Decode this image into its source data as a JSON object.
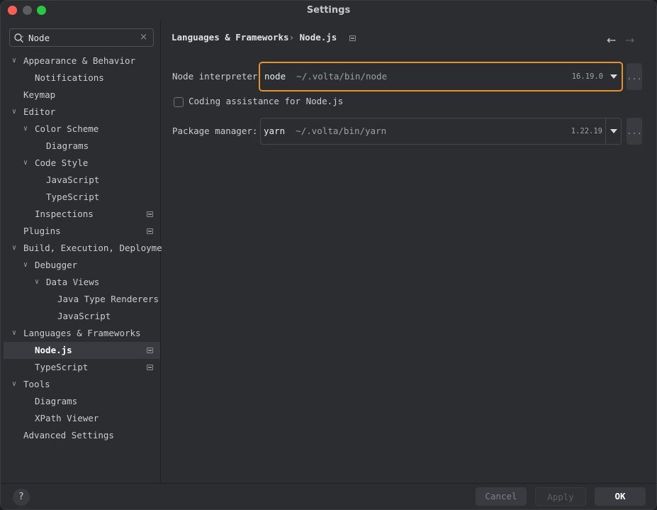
{
  "window": {
    "title": "Settings"
  },
  "sidebar": {
    "search": {
      "value": "Node",
      "clear_icon": "×"
    },
    "items": [
      {
        "label": "Appearance & Behavior",
        "level": 0,
        "expandable": true,
        "expanded": true
      },
      {
        "label": "Notifications",
        "level": 1
      },
      {
        "label": "Keymap",
        "level": 0
      },
      {
        "label": "Editor",
        "level": 0,
        "expandable": true,
        "expanded": true
      },
      {
        "label": "Color Scheme",
        "level": 1,
        "expandable": true,
        "expanded": true
      },
      {
        "label": "Diagrams",
        "level": 2
      },
      {
        "label": "Code Style",
        "level": 1,
        "expandable": true,
        "expanded": true
      },
      {
        "label": "JavaScript",
        "level": 2
      },
      {
        "label": "TypeScript",
        "level": 2
      },
      {
        "label": "Inspections",
        "level": 1,
        "project_icon": true
      },
      {
        "label": "Plugins",
        "level": 0,
        "project_icon": true
      },
      {
        "label": "Build, Execution, Deployment",
        "level": 0,
        "expandable": true,
        "expanded": true
      },
      {
        "label": "Debugger",
        "level": 1,
        "expandable": true,
        "expanded": true
      },
      {
        "label": "Data Views",
        "level": 2,
        "expandable": true,
        "expanded": true
      },
      {
        "label": "Java Type Renderers",
        "level": 3
      },
      {
        "label": "JavaScript",
        "level": 3
      },
      {
        "label": "Languages & Frameworks",
        "level": 0,
        "expandable": true,
        "expanded": true
      },
      {
        "label": "Node.js",
        "level": 1,
        "project_icon": true,
        "selected": true
      },
      {
        "label": "TypeScript",
        "level": 1,
        "project_icon": true
      },
      {
        "label": "Tools",
        "level": 0,
        "expandable": true,
        "expanded": true
      },
      {
        "label": "Diagrams",
        "level": 1
      },
      {
        "label": "XPath Viewer",
        "level": 1
      },
      {
        "label": "Advanced Settings",
        "level": 0
      }
    ]
  },
  "content": {
    "breadcrumb": {
      "parent": "Languages & Frameworks",
      "separator": "›",
      "current": "Node.js"
    },
    "nav": {
      "back_icon": "←",
      "forward_icon": "→"
    },
    "node_interpreter": {
      "label": "Node interpreter:",
      "name": "node",
      "path": "~/.volta/bin/node",
      "version": "16.19.0",
      "browse": "..."
    },
    "coding_assistance": {
      "label": "Coding assistance for Node.js",
      "checked": false
    },
    "package_manager": {
      "label": "Package manager:",
      "name": "yarn",
      "path": "~/.volta/bin/yarn",
      "version": "1.22.19",
      "browse": "..."
    }
  },
  "footer": {
    "help": "?",
    "cancel": "Cancel",
    "apply": "Apply",
    "ok": "OK"
  },
  "colors": {
    "focus_border": "#e8922b",
    "selection_bg": "#393b40",
    "window_bg": "#2b2d30"
  }
}
